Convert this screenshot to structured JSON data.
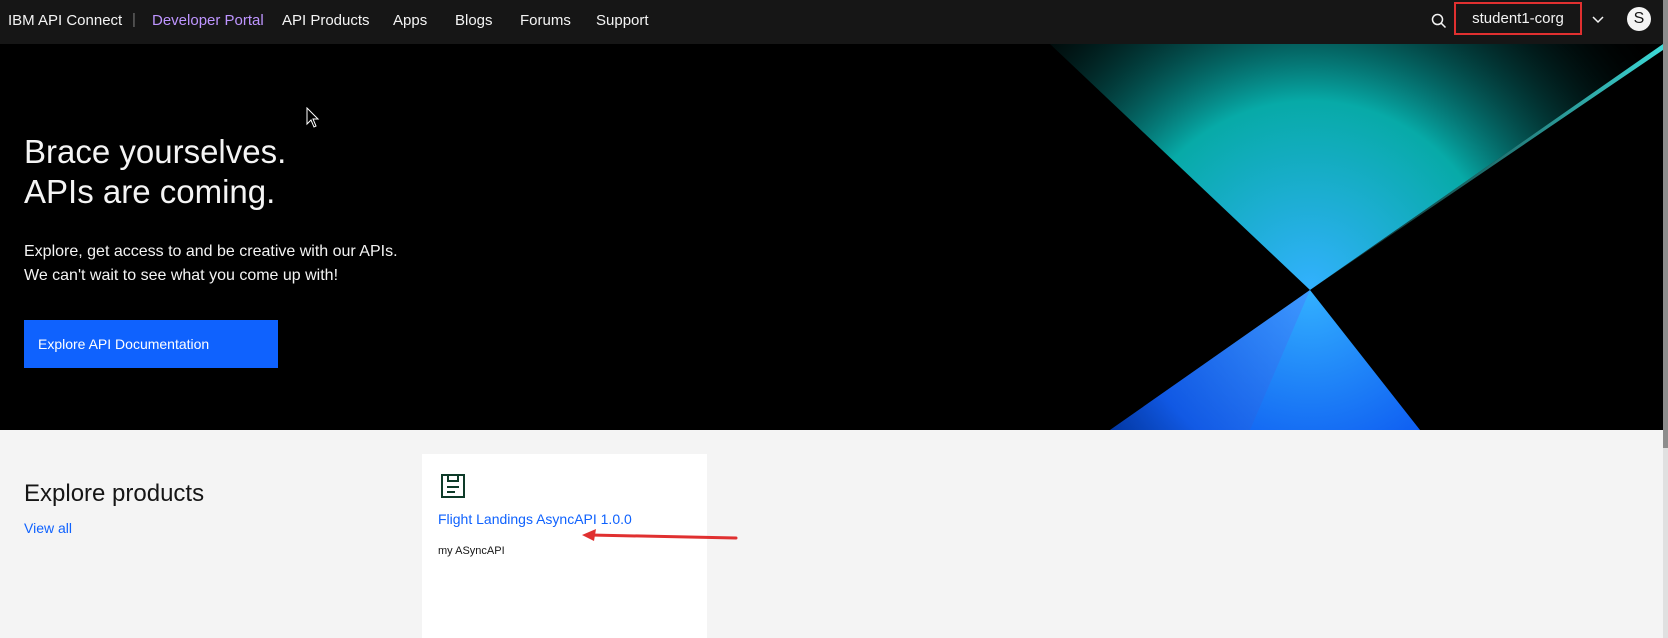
{
  "header": {
    "brand": "IBM API Connect",
    "separator": "|",
    "portal_label": "Developer Portal",
    "nav": [
      "API Products",
      "Apps",
      "Blogs",
      "Forums",
      "Support"
    ],
    "org": "student1-corg",
    "avatar_initial": "S",
    "icons": {
      "search": "search-icon",
      "dropdown": "chevron-down-icon"
    }
  },
  "hero": {
    "title_line1": "Brace yourselves.",
    "title_line2": "APIs are coming.",
    "text_line1": "Explore, get access to and be creative with our APIs.",
    "text_line2": "We can't wait to see what you come up with!",
    "button": "Explore API Documentation"
  },
  "products": {
    "heading": "Explore products",
    "view_all": "View all",
    "cards": [
      {
        "icon": "product-icon",
        "title": "Flight Landings AsyncAPI 1.0.0",
        "description": "my ASyncAPI"
      }
    ]
  },
  "colors": {
    "header_bg": "#161616",
    "portal_accent": "#be95ff",
    "primary": "#0f62fe",
    "annotation_red": "#e03030"
  }
}
